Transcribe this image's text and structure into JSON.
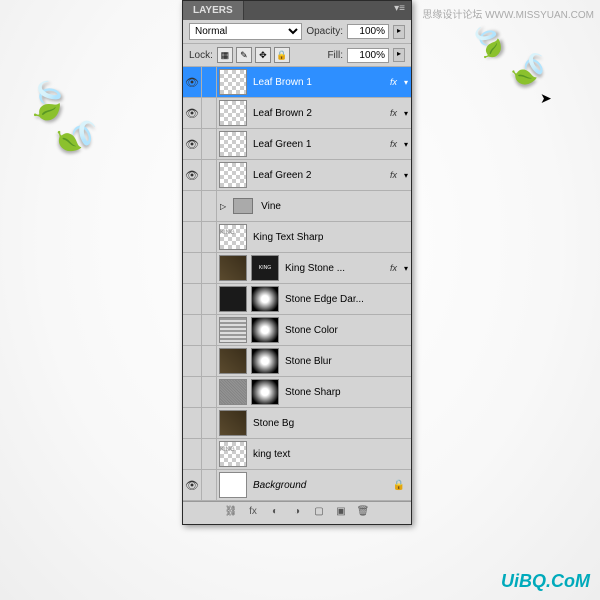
{
  "panel": {
    "title": "LAYERS"
  },
  "blend": {
    "mode": "Normal",
    "opacity_label": "Opacity:",
    "opacity": "100%",
    "fill_label": "Fill:",
    "fill": "100%",
    "lock_label": "Lock:"
  },
  "layers": [
    {
      "name": "Leaf Brown 1",
      "vis": true,
      "fx": true,
      "sel": true,
      "thumb": "checker"
    },
    {
      "name": "Leaf Brown 2",
      "vis": true,
      "fx": true,
      "thumb": "checker"
    },
    {
      "name": "Leaf Green 1",
      "vis": true,
      "fx": true,
      "thumb": "checker"
    },
    {
      "name": "Leaf Green 2",
      "vis": true,
      "fx": true,
      "thumb": "checker"
    },
    {
      "name": "Vine",
      "vis": false,
      "folder": true
    },
    {
      "name": "King Text Sharp",
      "vis": false,
      "thumb": "king"
    },
    {
      "name": "King Stone ...",
      "vis": false,
      "fx": true,
      "thumb": "tex",
      "thumb2": "dark"
    },
    {
      "name": "Stone Edge Dar...",
      "vis": false,
      "thumb": "dark",
      "thumb2": "grad"
    },
    {
      "name": "Stone Color",
      "vis": false,
      "thumb": "lines",
      "thumb2": "grad"
    },
    {
      "name": "Stone Blur",
      "vis": false,
      "thumb": "tex",
      "thumb2": "grad"
    },
    {
      "name": "Stone Sharp",
      "vis": false,
      "thumb": "noise",
      "thumb2": "grad"
    },
    {
      "name": "Stone Bg",
      "vis": false,
      "thumb": "tex"
    },
    {
      "name": "king text",
      "vis": false,
      "thumb": "king"
    },
    {
      "name": "Background",
      "vis": true,
      "thumb": "white",
      "locked": true,
      "italic": true
    }
  ],
  "watermark": {
    "top": "思缘设计论坛 WWW.MISSYUAN.COM",
    "bottom": "UiBQ.CoM"
  }
}
